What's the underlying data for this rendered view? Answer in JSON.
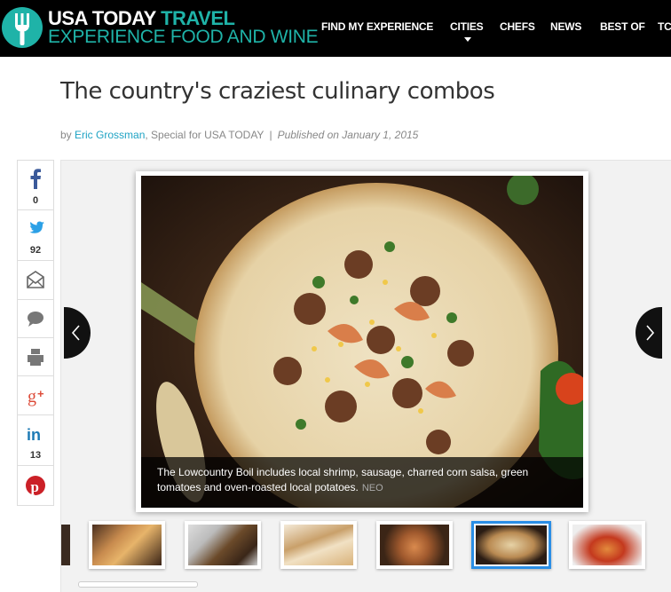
{
  "header": {
    "brand_main": "USA TODAY",
    "brand_accent": "TRAVEL",
    "brand_sub": "EXPERIENCE FOOD AND WINE",
    "accent_color": "#1fb3a8",
    "nav": [
      {
        "label": "FIND MY EXPERIENCE"
      },
      {
        "label": "CITIES"
      },
      {
        "label": "CHEFS"
      },
      {
        "label": "NEWS"
      },
      {
        "label": "BEST OF"
      },
      {
        "label": "TC"
      }
    ]
  },
  "article": {
    "title": "The country's craziest culinary combos",
    "by": "by ",
    "author": "Eric Grossman",
    "affiliation": ", Special for USA TODAY",
    "separator": "|",
    "published": "Published on January 1, 2015"
  },
  "share": [
    {
      "icon": "facebook-icon",
      "count": "0"
    },
    {
      "icon": "twitter-icon",
      "count": "92"
    },
    {
      "icon": "email-icon"
    },
    {
      "icon": "comment-icon"
    },
    {
      "icon": "print-icon"
    },
    {
      "icon": "google-plus-icon"
    },
    {
      "icon": "linkedin-icon",
      "count": "13"
    },
    {
      "icon": "pinterest-icon"
    }
  ],
  "gallery": {
    "caption": "The Lowcountry Boil includes local shrimp, sausage, charred corn salsa, green tomatoes and oven-roasted local potatoes.",
    "credit": "NEO",
    "active_thumb": 5
  }
}
